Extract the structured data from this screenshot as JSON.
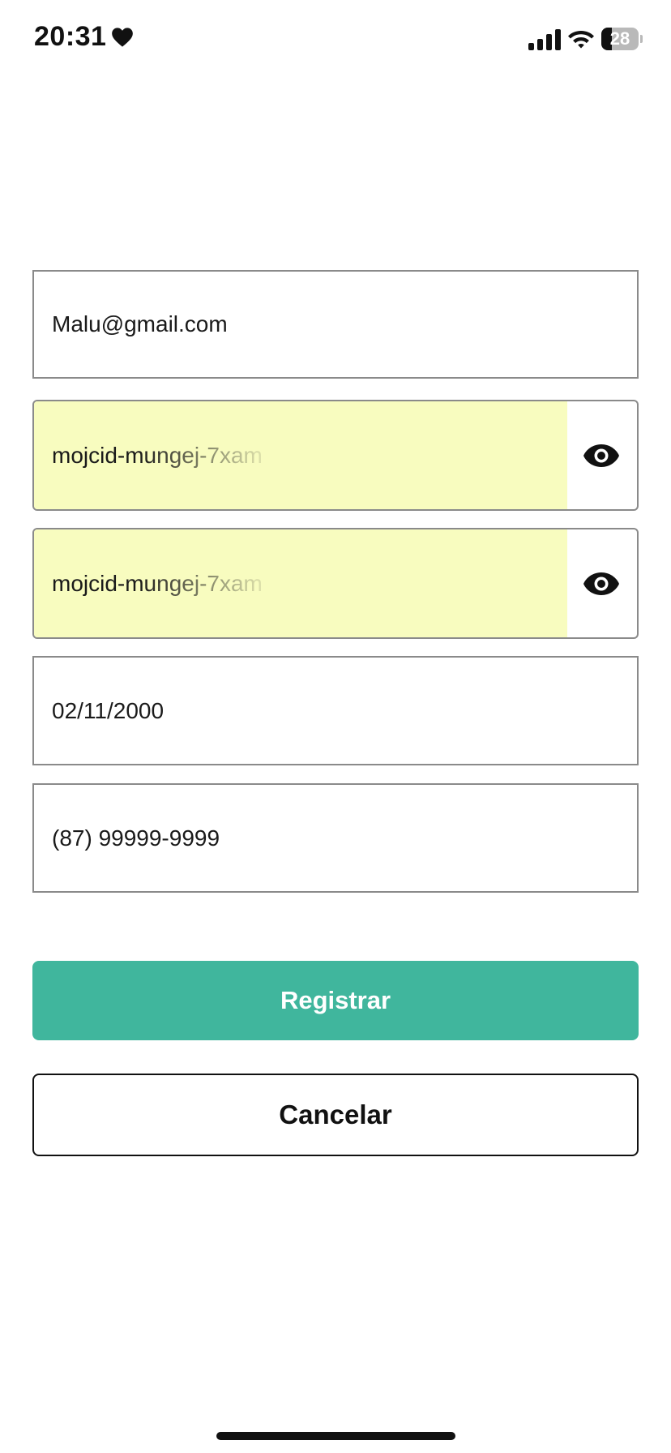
{
  "status_bar": {
    "time": "20:31",
    "battery_level": "28",
    "battery_fraction": 0.28,
    "icons": [
      "heart-icon",
      "signal-icon",
      "wifi-icon",
      "battery-icon"
    ]
  },
  "form": {
    "email_value": "Malu@gmail.com",
    "password_value": "mojcid-mungej-7xam",
    "confirm_password_value": "mojcid-mungej-7xam",
    "birthdate_value": "02/11/2000",
    "phone_value": "(87) 99999-9999",
    "password_toggle_icon": "eye-icon",
    "autofill_color": "#f8fcbf"
  },
  "actions": {
    "register_label": "Registrar",
    "cancel_label": "Cancelar",
    "primary_color": "#40b69d"
  }
}
